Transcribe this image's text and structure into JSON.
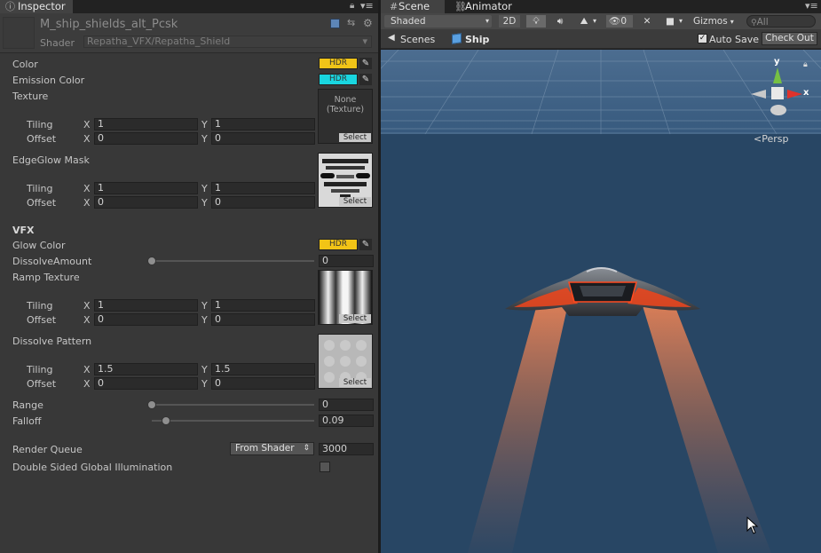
{
  "tabs": {
    "inspector": "Inspector",
    "scene": "Scene",
    "animator": "Animator"
  },
  "material": {
    "name": "M_ship_shields_alt_Pcsk",
    "shader_label": "Shader",
    "shader_value": "Repatha_VFX/Repatha_Shield"
  },
  "props": {
    "color": "Color",
    "emission": "Emission Color",
    "texture": "Texture",
    "tiling": "Tiling",
    "offset": "Offset",
    "x": "X",
    "y": "Y",
    "edge_mask": "EdgeGlow Mask",
    "vfx": "VFX",
    "glow": "Glow Color",
    "dissolve_amount": "DissolveAmount",
    "ramp": "Ramp Texture",
    "dissolve_pattern": "Dissolve Pattern",
    "range": "Range",
    "falloff": "Falloff",
    "render_queue": "Render Queue",
    "dsgi": "Double Sided Global Illumination"
  },
  "values": {
    "hdr": "HDR",
    "none_texture": "None\n(Texture)",
    "select": "Select",
    "tex_tx": "1",
    "tex_ty": "1",
    "tex_ox": "0",
    "tex_oy": "0",
    "edge_tx": "1",
    "edge_ty": "1",
    "edge_ox": "0",
    "edge_oy": "0",
    "ramp_tx": "1",
    "ramp_ty": "1",
    "ramp_ox": "0",
    "ramp_oy": "0",
    "diss_tx": "1.5",
    "diss_ty": "1.5",
    "diss_ox": "0",
    "diss_oy": "0",
    "dissolve_amount": "0",
    "range": "0",
    "falloff": "0.09",
    "dissolve_fraction": 0,
    "range_fraction": 0,
    "falloff_fraction": 0.09,
    "render_queue_mode": "From Shader",
    "render_queue_value": "3000"
  },
  "colors": {
    "color": "#f0c418",
    "emission": "#19d6e0",
    "glow": "#f2c416"
  },
  "scene": {
    "shading": "Shaded",
    "mode2d": "2D",
    "hidden_count": "0",
    "gizmos": "Gizmos",
    "search_placeholder": "All",
    "scenes": "Scenes",
    "ship": "Ship",
    "auto_save": "Auto Save",
    "check_out": "Check Out",
    "axis_y": "y",
    "axis_x": "x",
    "persp": "Persp"
  }
}
